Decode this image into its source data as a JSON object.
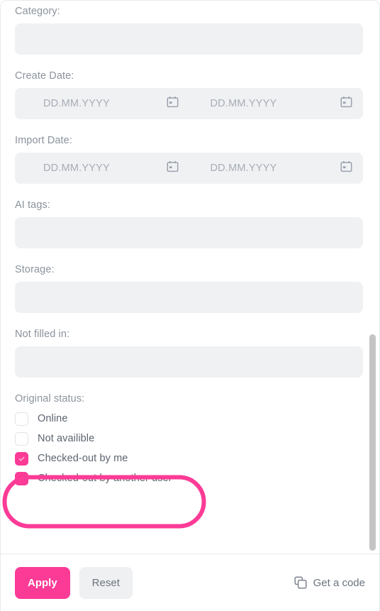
{
  "filter_panel": {
    "fields": [
      {
        "label": "Category:",
        "type": "text",
        "value": "",
        "name": "category"
      },
      {
        "label": "Create Date:",
        "type": "date_range",
        "from_placeholder": "DD.MM.YYYY",
        "to_placeholder": "DD.MM.YYYY",
        "from_value": "",
        "to_value": "",
        "name": "create-date"
      },
      {
        "label": "Import Date:",
        "type": "date_range",
        "from_placeholder": "DD.MM.YYYY",
        "to_placeholder": "DD.MM.YYYY",
        "from_value": "",
        "to_value": "",
        "name": "import-date"
      },
      {
        "label": "AI tags:",
        "type": "text",
        "value": "",
        "name": "ai-tags"
      },
      {
        "label": "Storage:",
        "type": "text",
        "value": "",
        "name": "storage"
      },
      {
        "label": "Not filled in:",
        "type": "text",
        "value": "",
        "name": "not-filled-in"
      }
    ],
    "original_status": {
      "label": "Original status:",
      "options": [
        {
          "label": "Online",
          "checked": false
        },
        {
          "label": "Not availible",
          "checked": false
        },
        {
          "label": "Checked-out by me",
          "checked": true
        },
        {
          "label": "Checked-out by another user",
          "checked": true
        }
      ]
    },
    "annotation": {
      "shape": "ellipse-highlight",
      "color": "#fb3b96",
      "targets": [
        "Checked-out by me",
        "Checked-out by another user"
      ]
    },
    "footer": {
      "apply_label": "Apply",
      "reset_label": "Reset",
      "get_code_label": "Get a code",
      "get_code_icon": "copy-icon"
    },
    "colors": {
      "accent_pink": "#fb3b96",
      "field_background": "#f0f1f3",
      "label_text": "#8b939d",
      "body_text": "#5d6570",
      "placeholder_text": "#a6adb6",
      "divider": "#e8eaed",
      "scrollbar_thumb": "#c4c4c4"
    },
    "icons": {
      "calendar": "calendar-icon"
    },
    "scrollbar": {
      "visible": true
    }
  }
}
